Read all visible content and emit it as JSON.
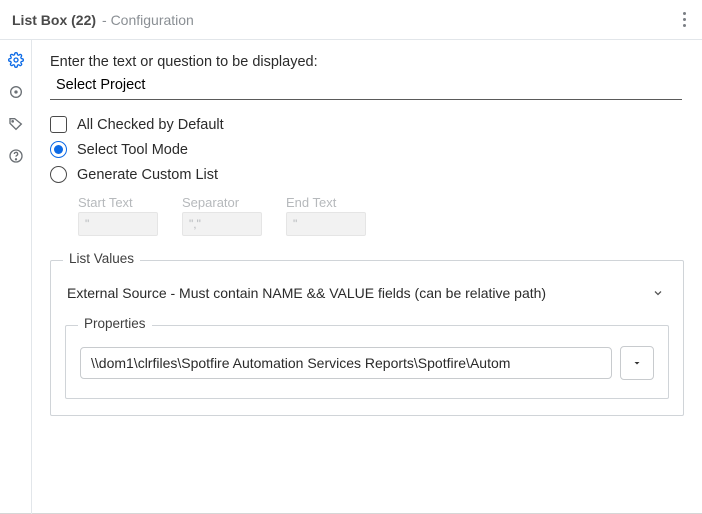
{
  "titlebar": {
    "title": "List Box (22)",
    "subtitle": "- Configuration"
  },
  "main": {
    "prompt_label": "Enter the text or question to be displayed:",
    "prompt_value": "Select Project"
  },
  "options": {
    "all_checked_label": "All Checked by Default",
    "all_checked": false,
    "select_tool_mode_label": "Select Tool Mode",
    "generate_custom_list_label": "Generate Custom List"
  },
  "custom_list_fields": {
    "start_text_label": "Start Text",
    "start_text_value": "\"",
    "separator_label": "Separator",
    "separator_value": "\",\"",
    "end_text_label": "End Text",
    "end_text_value": "\""
  },
  "list_values": {
    "legend": "List Values",
    "source_label": "External Source - Must contain NAME && VALUE fields  (can be relative path)"
  },
  "properties": {
    "legend": "Properties",
    "path_value": "\\\\dom1\\clrfiles\\Spotfire Automation Services Reports\\Spotfire\\Autom"
  }
}
